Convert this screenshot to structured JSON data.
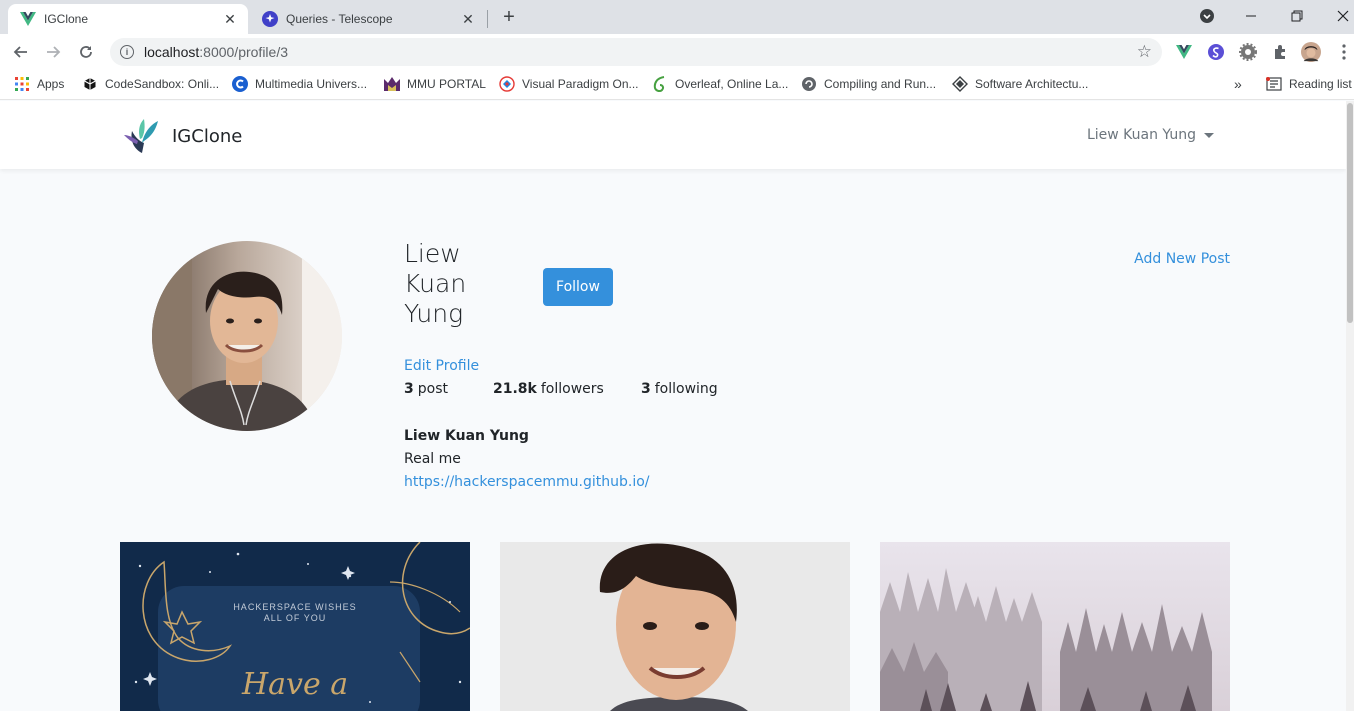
{
  "browser": {
    "tabs": [
      {
        "title": "IGClone",
        "active": true
      },
      {
        "title": "Queries - Telescope",
        "active": false
      }
    ],
    "url_host": "localhost",
    "url_path": ":8000/profile/3",
    "bookmarks": [
      {
        "label": "Apps",
        "icon": "apps-grid-icon"
      },
      {
        "label": "CodeSandbox: Onli...",
        "icon": "codesandbox-icon"
      },
      {
        "label": "Multimedia Univers...",
        "icon": "mmu-c-icon"
      },
      {
        "label": "MMU PORTAL",
        "icon": "mmu-portal-icon"
      },
      {
        "label": "Visual Paradigm On...",
        "icon": "visual-paradigm-icon"
      },
      {
        "label": "Overleaf, Online La...",
        "icon": "overleaf-icon"
      },
      {
        "label": "Compiling and Run...",
        "icon": "compiler-icon"
      },
      {
        "label": "Software Architectu...",
        "icon": "software-architecture-icon"
      }
    ],
    "reading_list": "Reading list"
  },
  "app": {
    "brand": "IGClone",
    "user_menu": "Liew Kuan Yung"
  },
  "profile": {
    "name_lines": [
      "Liew",
      "Kuan",
      "Yung"
    ],
    "follow_label": "Follow",
    "add_post_label": "Add New Post",
    "edit_profile_label": "Edit Profile",
    "posts_count": "3",
    "posts_label": "post",
    "followers_count": "21.8k",
    "followers_label": "followers",
    "following_count": "3",
    "following_label": "following",
    "bio_title": "Liew Kuan Yung",
    "bio_description": "Real me",
    "bio_url": "https://hackerspacemmu.github.io/"
  },
  "posts": [
    {
      "caption_line1": "HACKERSPACE WISHES",
      "caption_line2": "ALL OF YOU",
      "script_text": "Have a"
    }
  ],
  "colors": {
    "accent": "#3490dc",
    "page_bg": "#f8fafc"
  }
}
